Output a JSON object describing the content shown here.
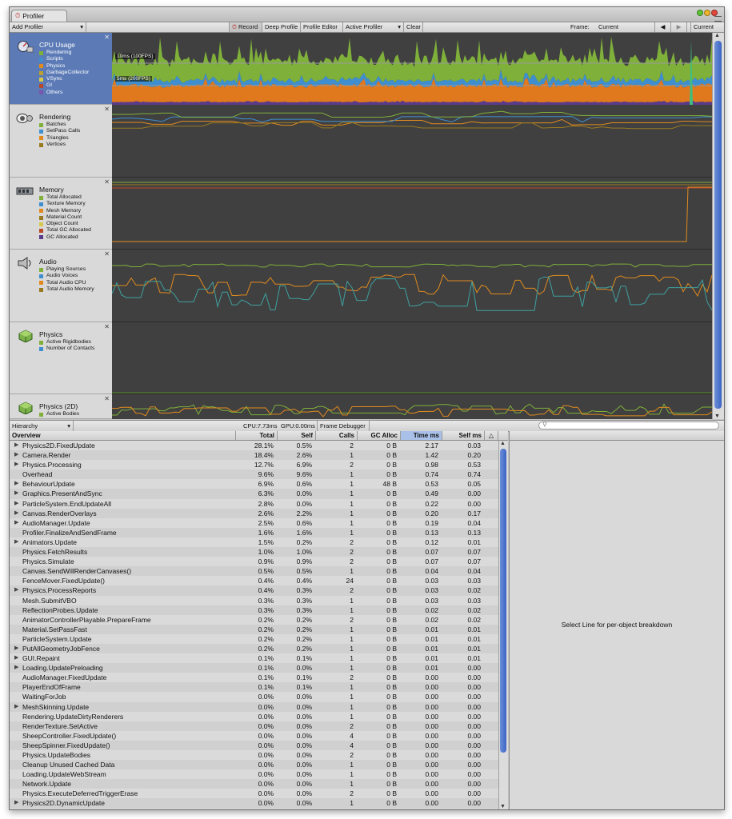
{
  "window": {
    "tab_title": "Profiler"
  },
  "toolbar": {
    "add_profiler": "Add Profiler",
    "record": "Record",
    "deep_profile": "Deep Profile",
    "profile_editor": "Profile Editor",
    "active_profiler": "Active Profiler",
    "clear": "Clear",
    "frame_label": "Frame:",
    "frame_value": "Current",
    "current_button": "Current"
  },
  "modules": [
    {
      "name": "CPU Usage",
      "icon": "cpu-icon",
      "selected": true,
      "legend": [
        {
          "label": "Rendering",
          "color": "#7fb03a"
        },
        {
          "label": "Scripts",
          "color": "#3f8fd0"
        },
        {
          "label": "Physics",
          "color": "#e08a1e"
        },
        {
          "label": "GarbageCollector",
          "color": "#b9a030"
        },
        {
          "label": "VSync",
          "color": "#d6c94a"
        },
        {
          "label": "GI",
          "color": "#b84a2a"
        },
        {
          "label": "Others",
          "color": "#7a55b0"
        }
      ]
    },
    {
      "name": "Rendering",
      "icon": "rendering-icon",
      "selected": false,
      "legend": [
        {
          "label": "Batches",
          "color": "#7fb03a"
        },
        {
          "label": "SetPass Calls",
          "color": "#3f8fd0"
        },
        {
          "label": "Triangles",
          "color": "#e08a1e"
        },
        {
          "label": "Vertices",
          "color": "#9a7a20"
        }
      ]
    },
    {
      "name": "Memory",
      "icon": "memory-icon",
      "selected": false,
      "legend": [
        {
          "label": "Total Allocated",
          "color": "#7fb03a"
        },
        {
          "label": "Texture Memory",
          "color": "#3f8fd0"
        },
        {
          "label": "Mesh Memory",
          "color": "#e08a1e"
        },
        {
          "label": "Material Count",
          "color": "#9a7a20"
        },
        {
          "label": "Object Count",
          "color": "#d6c94a"
        },
        {
          "label": "Total GC Allocated",
          "color": "#b84a2a"
        },
        {
          "label": "GC Allocated",
          "color": "#5a3a8a"
        }
      ]
    },
    {
      "name": "Audio",
      "icon": "audio-icon",
      "selected": false,
      "legend": [
        {
          "label": "Playing Sources",
          "color": "#7fb03a"
        },
        {
          "label": "Audio Voices",
          "color": "#3f8fd0"
        },
        {
          "label": "Total Audio CPU",
          "color": "#e08a1e"
        },
        {
          "label": "Total Audio Memory",
          "color": "#9a7a20"
        }
      ]
    },
    {
      "name": "Physics",
      "icon": "physics-icon",
      "selected": false,
      "legend": [
        {
          "label": "Active Rigidbodies",
          "color": "#7fb03a"
        },
        {
          "label": "Number of Contacts",
          "color": "#3f8fd0"
        }
      ]
    },
    {
      "name": "Physics (2D)",
      "icon": "physics2d-icon",
      "selected": false,
      "legend": [
        {
          "label": "Active Bodies",
          "color": "#7fb03a"
        }
      ]
    }
  ],
  "graph_labels": {
    "cpu_10ms": "10ms (100FPS)",
    "cpu_5ms": "5ms (200FPS)"
  },
  "hierarchy_bar": {
    "mode": "Hierarchy",
    "cpu": "CPU:7.73ms",
    "gpu": "GPU:0.00ms",
    "frame_debugger": "Frame Debugger"
  },
  "columns": [
    "Overview",
    "Total",
    "Self",
    "Calls",
    "GC Alloc",
    "Time ms",
    "Self ms"
  ],
  "rows": [
    {
      "name": "Physics2D.FixedUpdate",
      "exp": true,
      "total": "28.1%",
      "self": "0.5%",
      "calls": "2",
      "gc": "0 B",
      "time": "2.17",
      "selfms": "0.03"
    },
    {
      "name": "Camera.Render",
      "exp": true,
      "total": "18.4%",
      "self": "2.6%",
      "calls": "1",
      "gc": "0 B",
      "time": "1.42",
      "selfms": "0.20"
    },
    {
      "name": "Physics.Processing",
      "exp": true,
      "total": "12.7%",
      "self": "6.9%",
      "calls": "2",
      "gc": "0 B",
      "time": "0.98",
      "selfms": "0.53"
    },
    {
      "name": "Overhead",
      "exp": false,
      "total": "9.6%",
      "self": "9.6%",
      "calls": "1",
      "gc": "0 B",
      "time": "0.74",
      "selfms": "0.74"
    },
    {
      "name": "BehaviourUpdate",
      "exp": true,
      "total": "6.9%",
      "self": "0.6%",
      "calls": "1",
      "gc": "48 B",
      "time": "0.53",
      "selfms": "0.05"
    },
    {
      "name": "Graphics.PresentAndSync",
      "exp": true,
      "total": "6.3%",
      "self": "0.0%",
      "calls": "1",
      "gc": "0 B",
      "time": "0.49",
      "selfms": "0.00"
    },
    {
      "name": "ParticleSystem.EndUpdateAll",
      "exp": true,
      "total": "2.8%",
      "self": "0.0%",
      "calls": "1",
      "gc": "0 B",
      "time": "0.22",
      "selfms": "0.00"
    },
    {
      "name": "Canvas.RenderOverlays",
      "exp": true,
      "total": "2.6%",
      "self": "2.2%",
      "calls": "1",
      "gc": "0 B",
      "time": "0.20",
      "selfms": "0.17"
    },
    {
      "name": "AudioManager.Update",
      "exp": true,
      "total": "2.5%",
      "self": "0.6%",
      "calls": "1",
      "gc": "0 B",
      "time": "0.19",
      "selfms": "0.04"
    },
    {
      "name": "Profiler.FinalizeAndSendFrame",
      "exp": false,
      "total": "1.6%",
      "self": "1.6%",
      "calls": "1",
      "gc": "0 B",
      "time": "0.13",
      "selfms": "0.13"
    },
    {
      "name": "Animators.Update",
      "exp": true,
      "total": "1.5%",
      "self": "0.2%",
      "calls": "2",
      "gc": "0 B",
      "time": "0.12",
      "selfms": "0.01"
    },
    {
      "name": "Physics.FetchResults",
      "exp": false,
      "total": "1.0%",
      "self": "1.0%",
      "calls": "2",
      "gc": "0 B",
      "time": "0.07",
      "selfms": "0.07"
    },
    {
      "name": "Physics.Simulate",
      "exp": false,
      "total": "0.9%",
      "self": "0.9%",
      "calls": "2",
      "gc": "0 B",
      "time": "0.07",
      "selfms": "0.07"
    },
    {
      "name": "Canvas.SendWillRenderCanvases()",
      "exp": false,
      "total": "0.5%",
      "self": "0.5%",
      "calls": "1",
      "gc": "0 B",
      "time": "0.04",
      "selfms": "0.04"
    },
    {
      "name": "FenceMover.FixedUpdate()",
      "exp": false,
      "total": "0.4%",
      "self": "0.4%",
      "calls": "24",
      "gc": "0 B",
      "time": "0.03",
      "selfms": "0.03"
    },
    {
      "name": "Physics.ProcessReports",
      "exp": true,
      "total": "0.4%",
      "self": "0.3%",
      "calls": "2",
      "gc": "0 B",
      "time": "0.03",
      "selfms": "0.02"
    },
    {
      "name": "Mesh.SubmitVBO",
      "exp": false,
      "total": "0.3%",
      "self": "0.3%",
      "calls": "1",
      "gc": "0 B",
      "time": "0.03",
      "selfms": "0.03"
    },
    {
      "name": "ReflectionProbes.Update",
      "exp": false,
      "total": "0.3%",
      "self": "0.3%",
      "calls": "1",
      "gc": "0 B",
      "time": "0.02",
      "selfms": "0.02"
    },
    {
      "name": "AnimatorControllerPlayable.PrepareFrame",
      "exp": false,
      "total": "0.2%",
      "self": "0.2%",
      "calls": "2",
      "gc": "0 B",
      "time": "0.02",
      "selfms": "0.02"
    },
    {
      "name": "Material.SetPassFast",
      "exp": false,
      "total": "0.2%",
      "self": "0.2%",
      "calls": "1",
      "gc": "0 B",
      "time": "0.01",
      "selfms": "0.01"
    },
    {
      "name": "ParticleSystem.Update",
      "exp": false,
      "total": "0.2%",
      "self": "0.2%",
      "calls": "1",
      "gc": "0 B",
      "time": "0.01",
      "selfms": "0.01"
    },
    {
      "name": "PutAllGeometryJobFence",
      "exp": true,
      "total": "0.2%",
      "self": "0.2%",
      "calls": "1",
      "gc": "0 B",
      "time": "0.01",
      "selfms": "0.01"
    },
    {
      "name": "GUI.Repaint",
      "exp": true,
      "total": "0.1%",
      "self": "0.1%",
      "calls": "1",
      "gc": "0 B",
      "time": "0.01",
      "selfms": "0.01"
    },
    {
      "name": "Loading.UpdatePreloading",
      "exp": true,
      "total": "0.1%",
      "self": "0.0%",
      "calls": "1",
      "gc": "0 B",
      "time": "0.01",
      "selfms": "0.00"
    },
    {
      "name": "AudioManager.FixedUpdate",
      "exp": false,
      "total": "0.1%",
      "self": "0.1%",
      "calls": "2",
      "gc": "0 B",
      "time": "0.00",
      "selfms": "0.00"
    },
    {
      "name": "PlayerEndOfFrame",
      "exp": false,
      "total": "0.1%",
      "self": "0.1%",
      "calls": "1",
      "gc": "0 B",
      "time": "0.00",
      "selfms": "0.00"
    },
    {
      "name": "WaitingForJob",
      "exp": false,
      "total": "0.0%",
      "self": "0.0%",
      "calls": "1",
      "gc": "0 B",
      "time": "0.00",
      "selfms": "0.00"
    },
    {
      "name": "MeshSkinning.Update",
      "exp": true,
      "total": "0.0%",
      "self": "0.0%",
      "calls": "1",
      "gc": "0 B",
      "time": "0.00",
      "selfms": "0.00"
    },
    {
      "name": "Rendering.UpdateDirtyRenderers",
      "exp": false,
      "total": "0.0%",
      "self": "0.0%",
      "calls": "1",
      "gc": "0 B",
      "time": "0.00",
      "selfms": "0.00"
    },
    {
      "name": "RenderTexture.SetActive",
      "exp": false,
      "total": "0.0%",
      "self": "0.0%",
      "calls": "2",
      "gc": "0 B",
      "time": "0.00",
      "selfms": "0.00"
    },
    {
      "name": "SheepController.FixedUpdate()",
      "exp": false,
      "total": "0.0%",
      "self": "0.0%",
      "calls": "4",
      "gc": "0 B",
      "time": "0.00",
      "selfms": "0.00"
    },
    {
      "name": "SheepSpinner.FixedUpdate()",
      "exp": false,
      "total": "0.0%",
      "self": "0.0%",
      "calls": "4",
      "gc": "0 B",
      "time": "0.00",
      "selfms": "0.00"
    },
    {
      "name": "Physics.UpdateBodies",
      "exp": false,
      "total": "0.0%",
      "self": "0.0%",
      "calls": "2",
      "gc": "0 B",
      "time": "0.00",
      "selfms": "0.00"
    },
    {
      "name": "Cleanup Unused Cached Data",
      "exp": false,
      "total": "0.0%",
      "self": "0.0%",
      "calls": "1",
      "gc": "0 B",
      "time": "0.00",
      "selfms": "0.00"
    },
    {
      "name": "Loading.UpdateWebStream",
      "exp": false,
      "total": "0.0%",
      "self": "0.0%",
      "calls": "1",
      "gc": "0 B",
      "time": "0.00",
      "selfms": "0.00"
    },
    {
      "name": "Network.Update",
      "exp": false,
      "total": "0.0%",
      "self": "0.0%",
      "calls": "1",
      "gc": "0 B",
      "time": "0.00",
      "selfms": "0.00"
    },
    {
      "name": "Physics.ExecuteDeferredTriggerErase",
      "exp": false,
      "total": "0.0%",
      "self": "0.0%",
      "calls": "2",
      "gc": "0 B",
      "time": "0.00",
      "selfms": "0.00"
    },
    {
      "name": "Physics2D.DynamicUpdate",
      "exp": true,
      "total": "0.0%",
      "self": "0.0%",
      "calls": "1",
      "gc": "0 B",
      "time": "0.00",
      "selfms": "0.00"
    }
  ],
  "detail_message": "Select Line for per-object breakdown"
}
